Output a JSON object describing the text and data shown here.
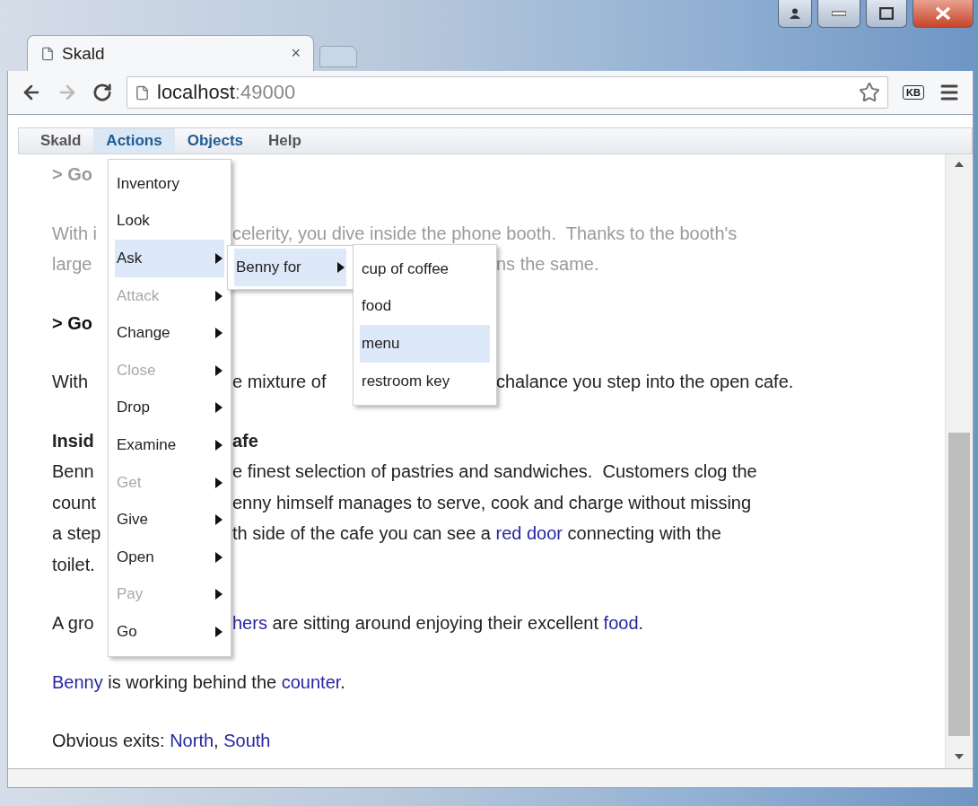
{
  "browser": {
    "tab_title": "Skald",
    "tab_close": "×",
    "url_host": "localhost",
    "url_port": ":49000",
    "kb_label": "KB"
  },
  "menubar": [
    {
      "label": "Skald",
      "selected": false,
      "kind": "app"
    },
    {
      "label": "Actions",
      "selected": true,
      "kind": "menu"
    },
    {
      "label": "Objects",
      "selected": false,
      "kind": "menu"
    },
    {
      "label": "Help",
      "selected": false,
      "kind": "app"
    }
  ],
  "menu": {
    "items": [
      {
        "label": "Inventory",
        "disabled": false,
        "selected": false,
        "submenu": false
      },
      {
        "label": "Look",
        "disabled": false,
        "selected": false,
        "submenu": false
      },
      {
        "label": "Ask",
        "disabled": false,
        "selected": true,
        "submenu": true
      },
      {
        "label": "Attack",
        "disabled": true,
        "selected": false,
        "submenu": true
      },
      {
        "label": "Change",
        "disabled": false,
        "selected": false,
        "submenu": true
      },
      {
        "label": "Close",
        "disabled": true,
        "selected": false,
        "submenu": true
      },
      {
        "label": "Drop",
        "disabled": false,
        "selected": false,
        "submenu": true
      },
      {
        "label": "Examine",
        "disabled": false,
        "selected": false,
        "submenu": true
      },
      {
        "label": "Get",
        "disabled": true,
        "selected": false,
        "submenu": true
      },
      {
        "label": "Give",
        "disabled": false,
        "selected": false,
        "submenu": true
      },
      {
        "label": "Open",
        "disabled": false,
        "selected": false,
        "submenu": true
      },
      {
        "label": "Pay",
        "disabled": true,
        "selected": false,
        "submenu": true
      },
      {
        "label": "Go",
        "disabled": false,
        "selected": false,
        "submenu": true
      }
    ]
  },
  "submenu": {
    "items": [
      {
        "label": "Benny for",
        "disabled": false,
        "selected": true,
        "submenu": true
      }
    ]
  },
  "submenu_2": {
    "items": [
      {
        "label": "cup of coffee",
        "disabled": false,
        "selected": false,
        "submenu": false
      },
      {
        "label": "food",
        "disabled": false,
        "selected": false,
        "submenu": false
      },
      {
        "label": "menu",
        "disabled": false,
        "selected": true,
        "submenu": false
      },
      {
        "label": "restroom key",
        "disabled": false,
        "selected": false,
        "submenu": false
      }
    ]
  },
  "content": {
    "paragraphs": [
      {
        "kind": "echo-past",
        "lines": [
          {
            "left": [
              {
                "text": "> Go",
                "link": false
              }
            ]
          }
        ]
      },
      {
        "kind": "past",
        "lines": [
          {
            "left": [
              {
                "text": "With i",
                "link": false
              }
            ],
            "middle": [
              {
                "text": "celerity, you dive inside the phone booth.  Thanks to the booth's",
                "link": false
              }
            ]
          },
          {
            "left": [
              {
                "text": "large",
                "link": false
              }
            ],
            "right": [
              {
                "text": "ns the same.",
                "link": false
              }
            ]
          }
        ]
      },
      {
        "kind": "echo",
        "lines": [
          {
            "left": [
              {
                "text": "> Go",
                "link": false
              }
            ]
          }
        ]
      },
      {
        "kind": "text",
        "lines": [
          {
            "left": [
              {
                "text": "With",
                "link": false
              }
            ],
            "middle": [
              {
                "text": "e mixture of",
                "link": false
              }
            ],
            "right": [
              {
                "text": "chalance you step into the open cafe.",
                "link": false
              }
            ]
          }
        ]
      },
      {
        "kind": "text",
        "lines": [
          {
            "kind": "heading",
            "left": [
              {
                "text": "Insid",
                "link": false
              }
            ],
            "middle": [
              {
                "text": "afe",
                "link": false
              }
            ]
          },
          {
            "left": [
              {
                "text": "Benn",
                "link": false
              }
            ],
            "middle": [
              {
                "text": "e finest selection of pastries and sandwiches.  Customers clog the",
                "link": false
              }
            ]
          },
          {
            "left": [
              {
                "text": "count",
                "link": false
              }
            ],
            "middle": [
              {
                "text": "enny himself manages to serve, cook and charge without missing",
                "link": false
              }
            ]
          },
          {
            "left": [
              {
                "text": "a step",
                "link": false
              }
            ],
            "middle": [
              {
                "text": "th side of the cafe you can see a ",
                "link": false
              },
              {
                "text": "red door",
                "link": true
              },
              {
                "text": " connecting with the",
                "link": false
              }
            ]
          },
          {
            "left": [
              {
                "text": "toilet.",
                "link": false
              }
            ]
          }
        ]
      },
      {
        "kind": "text",
        "lines": [
          {
            "left": [
              {
                "text": "A gro",
                "link": false
              }
            ],
            "middle": [
              {
                "text": "hers",
                "link": true
              },
              {
                "text": " are sitting around enjoying their excellent ",
                "link": false
              },
              {
                "text": "food",
                "link": true
              },
              {
                "text": ".",
                "link": false
              }
            ]
          }
        ]
      },
      {
        "kind": "text",
        "lines": [
          {
            "full": [
              {
                "text": "Benny",
                "link": true
              },
              {
                "text": " is working behind the ",
                "link": false
              },
              {
                "text": "counter",
                "link": true
              },
              {
                "text": ".",
                "link": false
              }
            ]
          }
        ]
      },
      {
        "kind": "text",
        "lines": [
          {
            "full": [
              {
                "text": "Obvious exits: ",
                "link": false
              },
              {
                "text": "North",
                "link": true
              },
              {
                "text": ", ",
                "link": false
              },
              {
                "text": "South",
                "link": true
              }
            ]
          }
        ]
      }
    ]
  }
}
